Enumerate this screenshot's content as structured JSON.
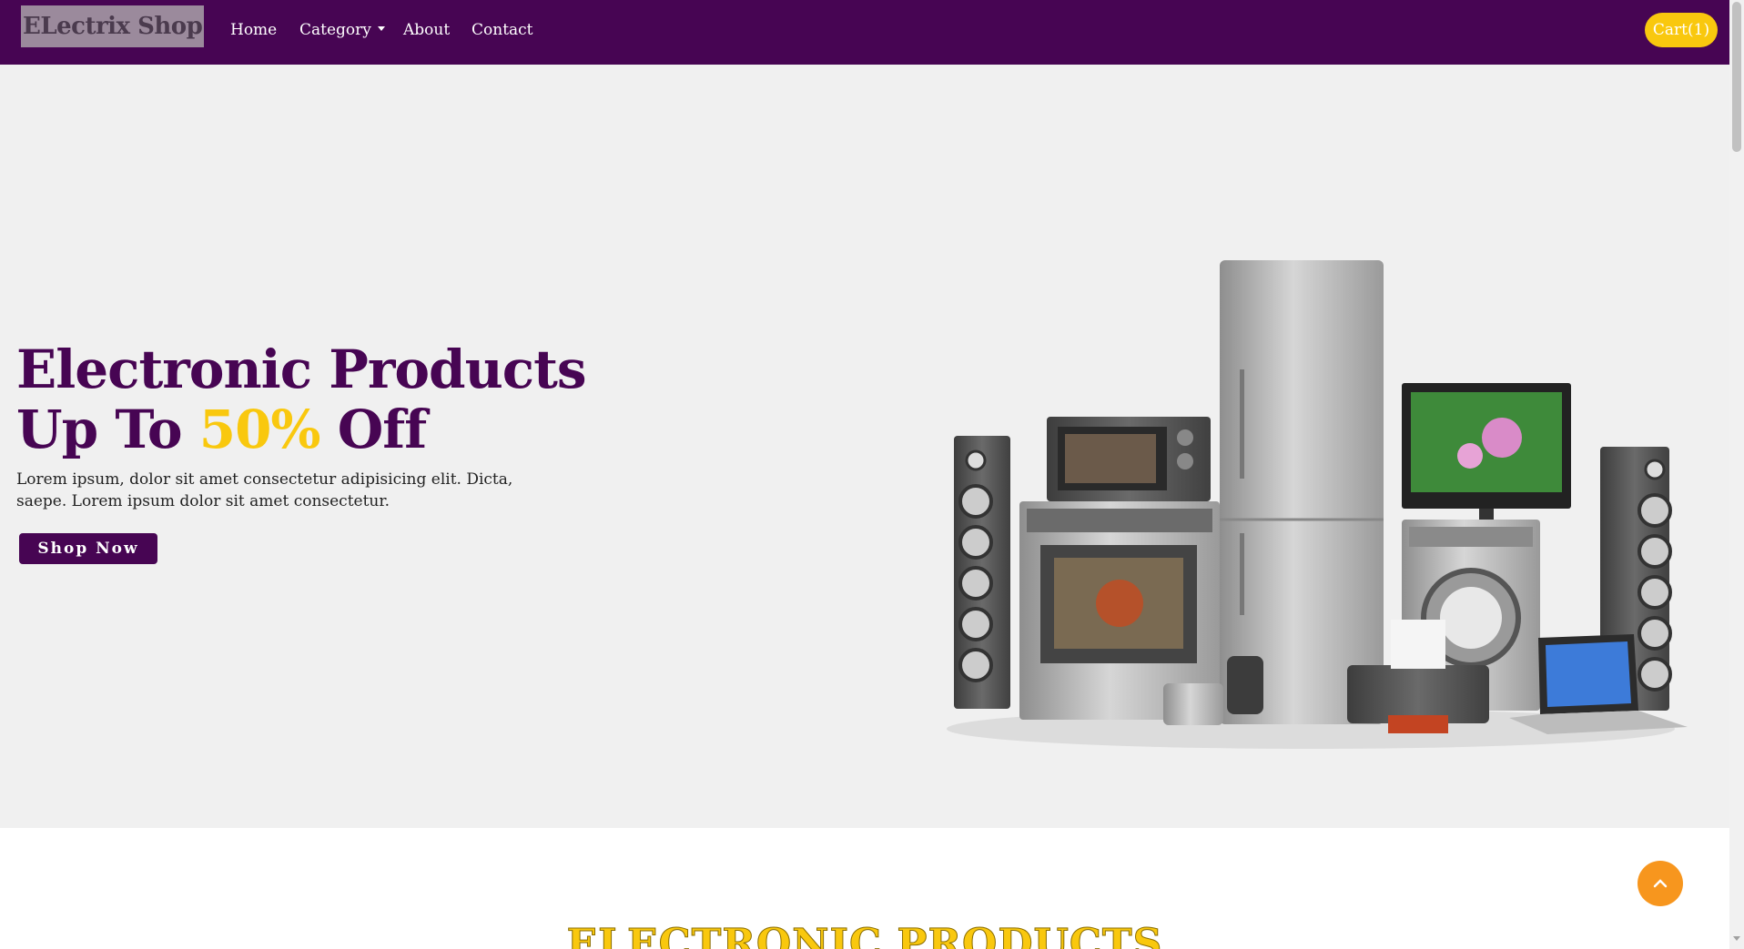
{
  "navbar": {
    "brand": "ELectrix Shop",
    "links": [
      "Home",
      "Category",
      "About",
      "Contact"
    ],
    "cart_label": "Cart(1)"
  },
  "hero": {
    "title_line1": "Electronic Products",
    "title_line2_prefix": "Up To ",
    "title_highlight": "50%",
    "title_line2_suffix": " Off",
    "description": "Lorem ipsum, dolor sit amet consectetur adipisicing elit. Dicta, saepe. Lorem ipsum dolor sit amet consectetur.",
    "cta_label": "Shop Now",
    "image_icon": "home-appliances-image"
  },
  "section": {
    "title": "ELECTRONIC PRODUCTS"
  },
  "icons": {
    "to_top": "chevron-up-icon",
    "category_caret": "caret-down-icon"
  },
  "colors": {
    "primary": "#470553",
    "accent": "#f9c80e",
    "orange": "#f7961e",
    "hero_bg": "#f0f0f0"
  }
}
